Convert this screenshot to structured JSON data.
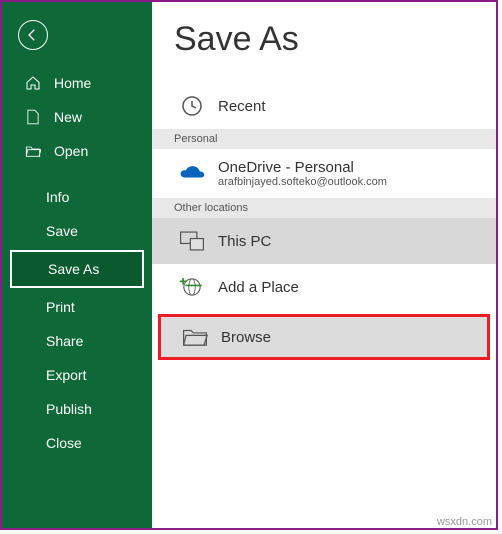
{
  "sidebar": {
    "nav1": [
      {
        "label": "Home"
      },
      {
        "label": "New"
      },
      {
        "label": "Open"
      }
    ],
    "nav2": [
      {
        "label": "Info"
      },
      {
        "label": "Save"
      },
      {
        "label": "Save As",
        "selected": true
      },
      {
        "label": "Print"
      },
      {
        "label": "Share"
      },
      {
        "label": "Export"
      },
      {
        "label": "Publish"
      },
      {
        "label": "Close"
      }
    ]
  },
  "main": {
    "title": "Save As",
    "recent_label": "Recent",
    "section_personal": "Personal",
    "onedrive_title": "OneDrive - Personal",
    "onedrive_email": "arafbinjayed.softeko@outlook.com",
    "section_other": "Other locations",
    "thispc_label": "This PC",
    "addplace_label": "Add a Place",
    "browse_label": "Browse"
  },
  "watermark": "wsxdn.com"
}
